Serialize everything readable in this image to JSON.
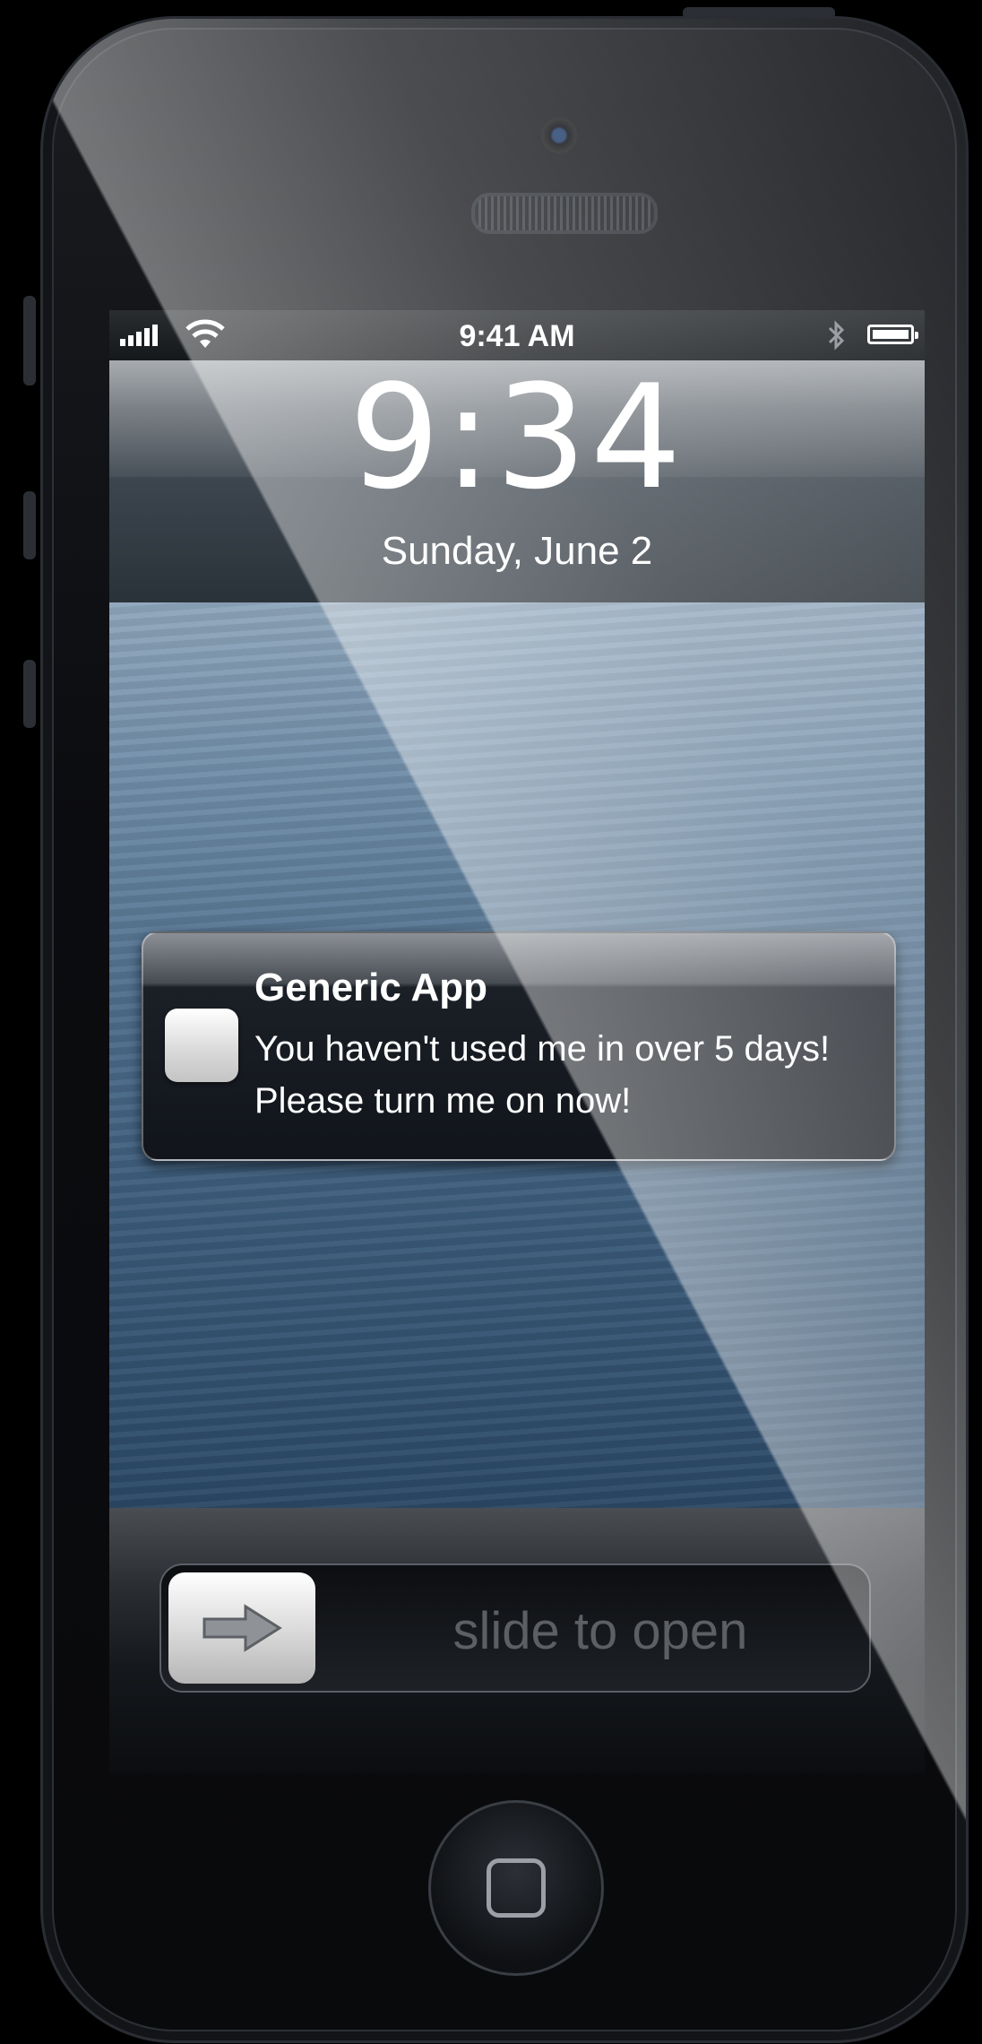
{
  "status_bar": {
    "time": "9:41 AM",
    "signal_icon": "signal-bars-icon",
    "wifi_icon": "wifi-icon",
    "bluetooth_icon": "bluetooth-icon",
    "battery_icon": "battery-icon",
    "battery_level": 1.0
  },
  "lock_screen": {
    "clock": "9:34",
    "date": "Sunday, June 2"
  },
  "notification": {
    "app_name": "Generic App",
    "message": "You haven't used me in over 5 days!  Please turn me on now!",
    "icon": "app-icon"
  },
  "unlock": {
    "label": "slide to open",
    "knob_icon": "arrow-right-icon"
  },
  "hardware": {
    "home_button_icon": "home-square-icon"
  }
}
